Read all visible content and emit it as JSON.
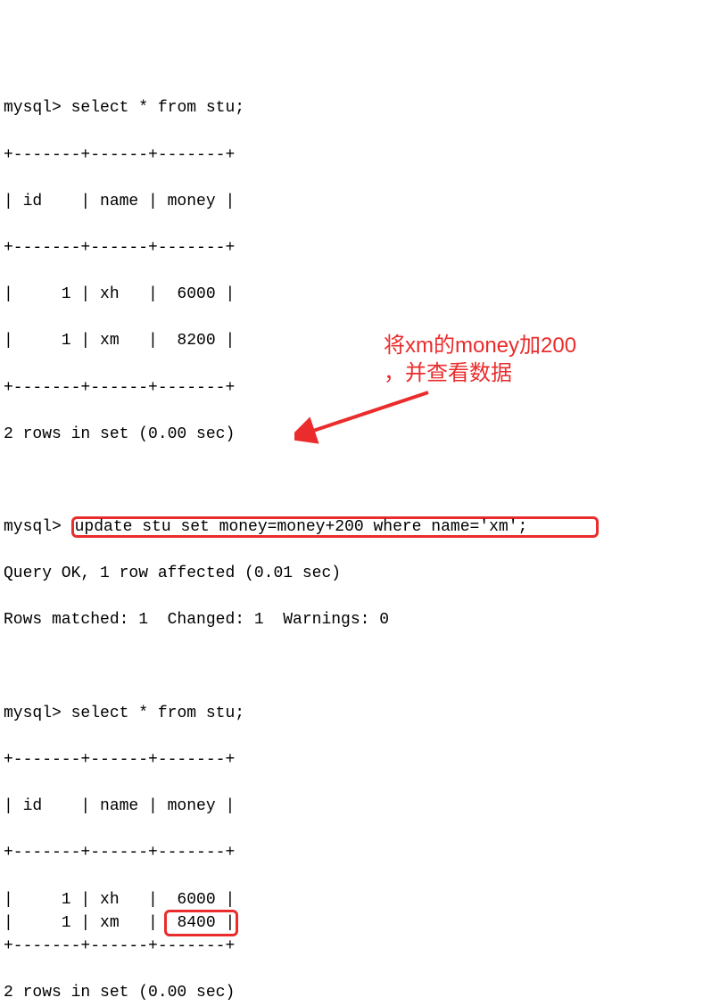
{
  "prompt": "mysql>",
  "query1": {
    "sql": "select * from stu;",
    "border": "+-------+------+-------+",
    "header": "| id    | name | money |",
    "rows": [
      "|     1 | xh   |  6000 |",
      "|     1 | xm   |  8200 |"
    ],
    "status": "2 rows in set (0.00 sec)"
  },
  "query2": {
    "sql": "update stu set money=money+200 where name='xm';",
    "result1": "Query OK, 1 row affected (0.01 sec)",
    "result2": "Rows matched: 1  Changed: 1  Warnings: 0"
  },
  "query3": {
    "sql": "select * from stu;",
    "border": "+-------+------+-------+",
    "header": "| id    | name | money |",
    "rows_prefix": "|     1 | xh   |  6000 |\n|     1 | xm   | ",
    "highlighted_value": "8400 |",
    "status": "2 rows in set (0.00 sec)"
  },
  "annotation": {
    "line1": "将xm的money加200",
    "line2": "，并查看数据"
  }
}
